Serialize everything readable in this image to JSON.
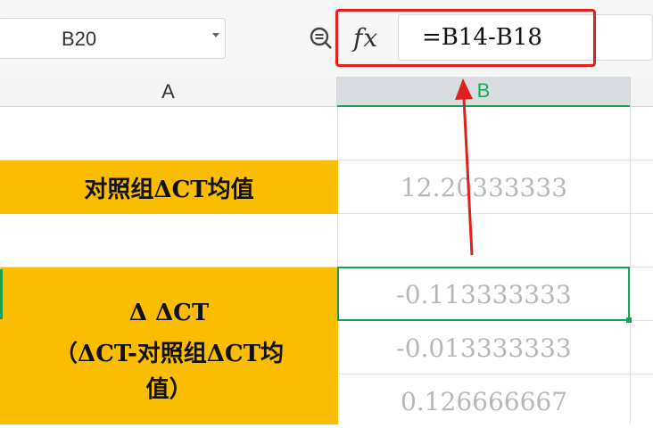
{
  "formula_bar": {
    "cell_ref": "B20",
    "fx_label": "fx",
    "formula": "=B14-B18"
  },
  "columns": {
    "a": "A",
    "b": "B"
  },
  "cells": {
    "a16": "对照组ΔCT均值",
    "a20_lines": [
      "Δ ΔCT",
      "（ΔCT-对照组ΔCT均",
      "值）"
    ],
    "b16": "12.20333333",
    "b20": "-0.113333333",
    "b21": "-0.013333333",
    "b22": "0.126666667"
  },
  "colors": {
    "highlight": "#fbbd00",
    "selection": "#1a9f50",
    "annotation": "#e0201c"
  }
}
